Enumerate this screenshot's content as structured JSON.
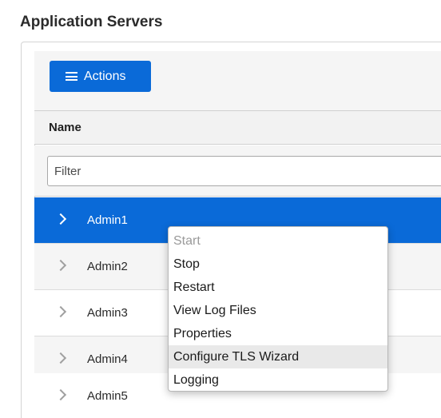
{
  "page": {
    "title": "Application Servers"
  },
  "toolbar": {
    "actions_label": "Actions",
    "actions_icon": "hamburger-menu-icon"
  },
  "table": {
    "column_header": "Name",
    "filter_placeholder": "Filter",
    "rows": [
      {
        "label": "Admin1",
        "selected": true
      },
      {
        "label": "Admin2",
        "selected": false
      },
      {
        "label": "Admin3",
        "selected": false
      },
      {
        "label": "Admin4",
        "selected": false
      },
      {
        "label": "Admin5",
        "selected": false
      }
    ]
  },
  "context_menu": {
    "items": [
      {
        "label": "Start",
        "disabled": true
      },
      {
        "label": "Stop",
        "disabled": false
      },
      {
        "label": "Restart",
        "disabled": false
      },
      {
        "label": "View Log Files",
        "disabled": false
      },
      {
        "label": "Properties",
        "disabled": false
      },
      {
        "label": "Configure TLS Wizard",
        "disabled": false,
        "highlighted": true
      },
      {
        "label": "Logging",
        "disabled": false
      }
    ]
  },
  "colors": {
    "accent": "#0a6ad8",
    "menu_hover": "#e9e9e9",
    "disabled_text": "#9a9a9a"
  }
}
